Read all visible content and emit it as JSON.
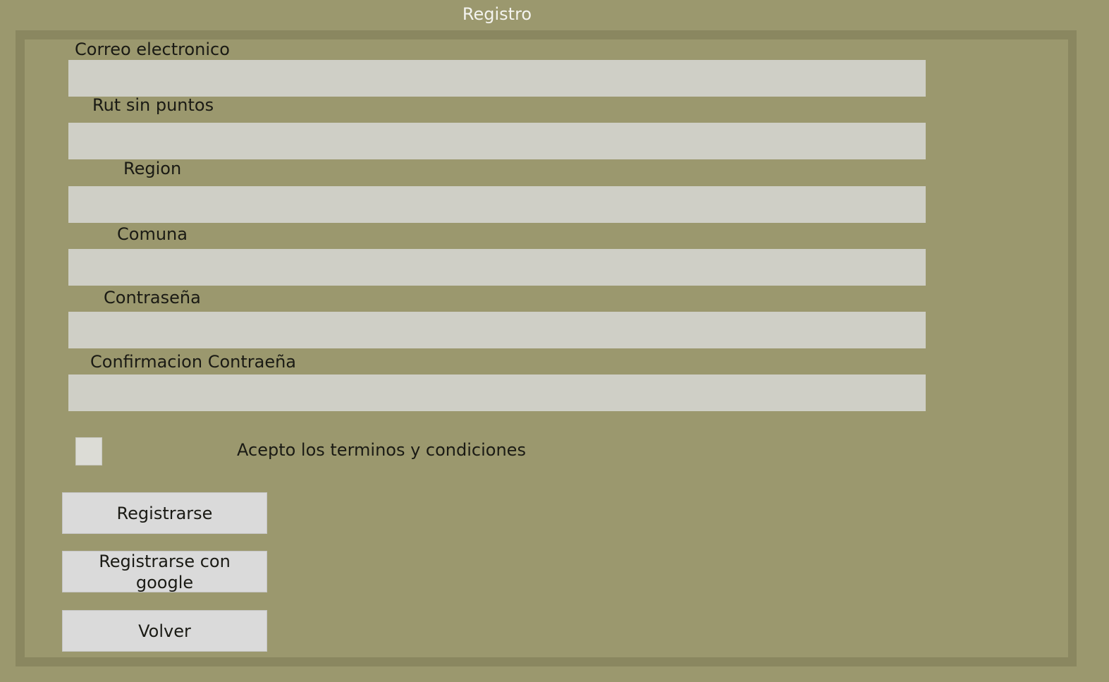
{
  "page": {
    "title": "Registro"
  },
  "form": {
    "fields": [
      {
        "label": "Correo electronico",
        "value": "",
        "placeholder": ""
      },
      {
        "label": "Rut sin puntos",
        "value": "",
        "placeholder": ""
      },
      {
        "label": "Region",
        "value": "",
        "placeholder": ""
      },
      {
        "label": "Comuna",
        "value": "",
        "placeholder": ""
      },
      {
        "label": "Contraseña",
        "value": "",
        "placeholder": ""
      },
      {
        "label": "Confirmacion Contraeña",
        "value": "",
        "placeholder": ""
      }
    ],
    "terms_label": "Acepto los terminos y condiciones",
    "terms_checked": false
  },
  "buttons": {
    "register": "Registrarse",
    "register_google": "Registrarse con google",
    "back": "Volver"
  },
  "colors": {
    "background": "#9b986e",
    "frame": "#8a8760",
    "input": "#cfcfc6",
    "button": "#dadada"
  }
}
